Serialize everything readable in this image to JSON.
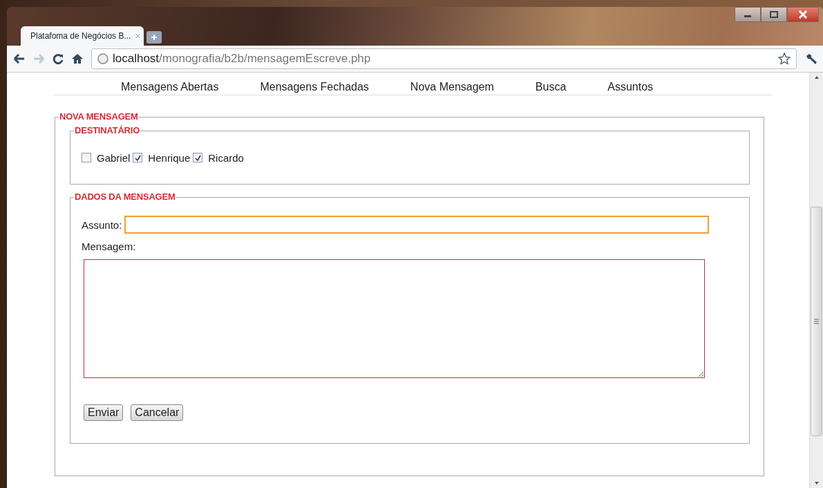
{
  "browser": {
    "tab": {
      "title": "Platafoma de Negócios B...",
      "close": "×"
    },
    "address": {
      "host": "localhost",
      "path": "/monografia/b2b/mensagemEscreve.php"
    }
  },
  "nav": [
    "Mensagens Abertas",
    "Mensagens Fechadas",
    "Nova Mensagem",
    "Busca",
    "Assuntos"
  ],
  "form": {
    "legend": "NOVA MENSAGEM",
    "recipients": {
      "legend": "DESTINATÁRIO",
      "items": [
        {
          "label": "Gabriel",
          "checked": false
        },
        {
          "label": "Henrique",
          "checked": true
        },
        {
          "label": "Ricardo",
          "checked": true
        }
      ]
    },
    "message": {
      "legend": "DADOS DA MENSAGEM",
      "subject_label": "Assunto:",
      "subject_focused": true,
      "body_label": "Mensagem:"
    },
    "buttons": [
      "Enviar",
      "Cancelar"
    ]
  }
}
